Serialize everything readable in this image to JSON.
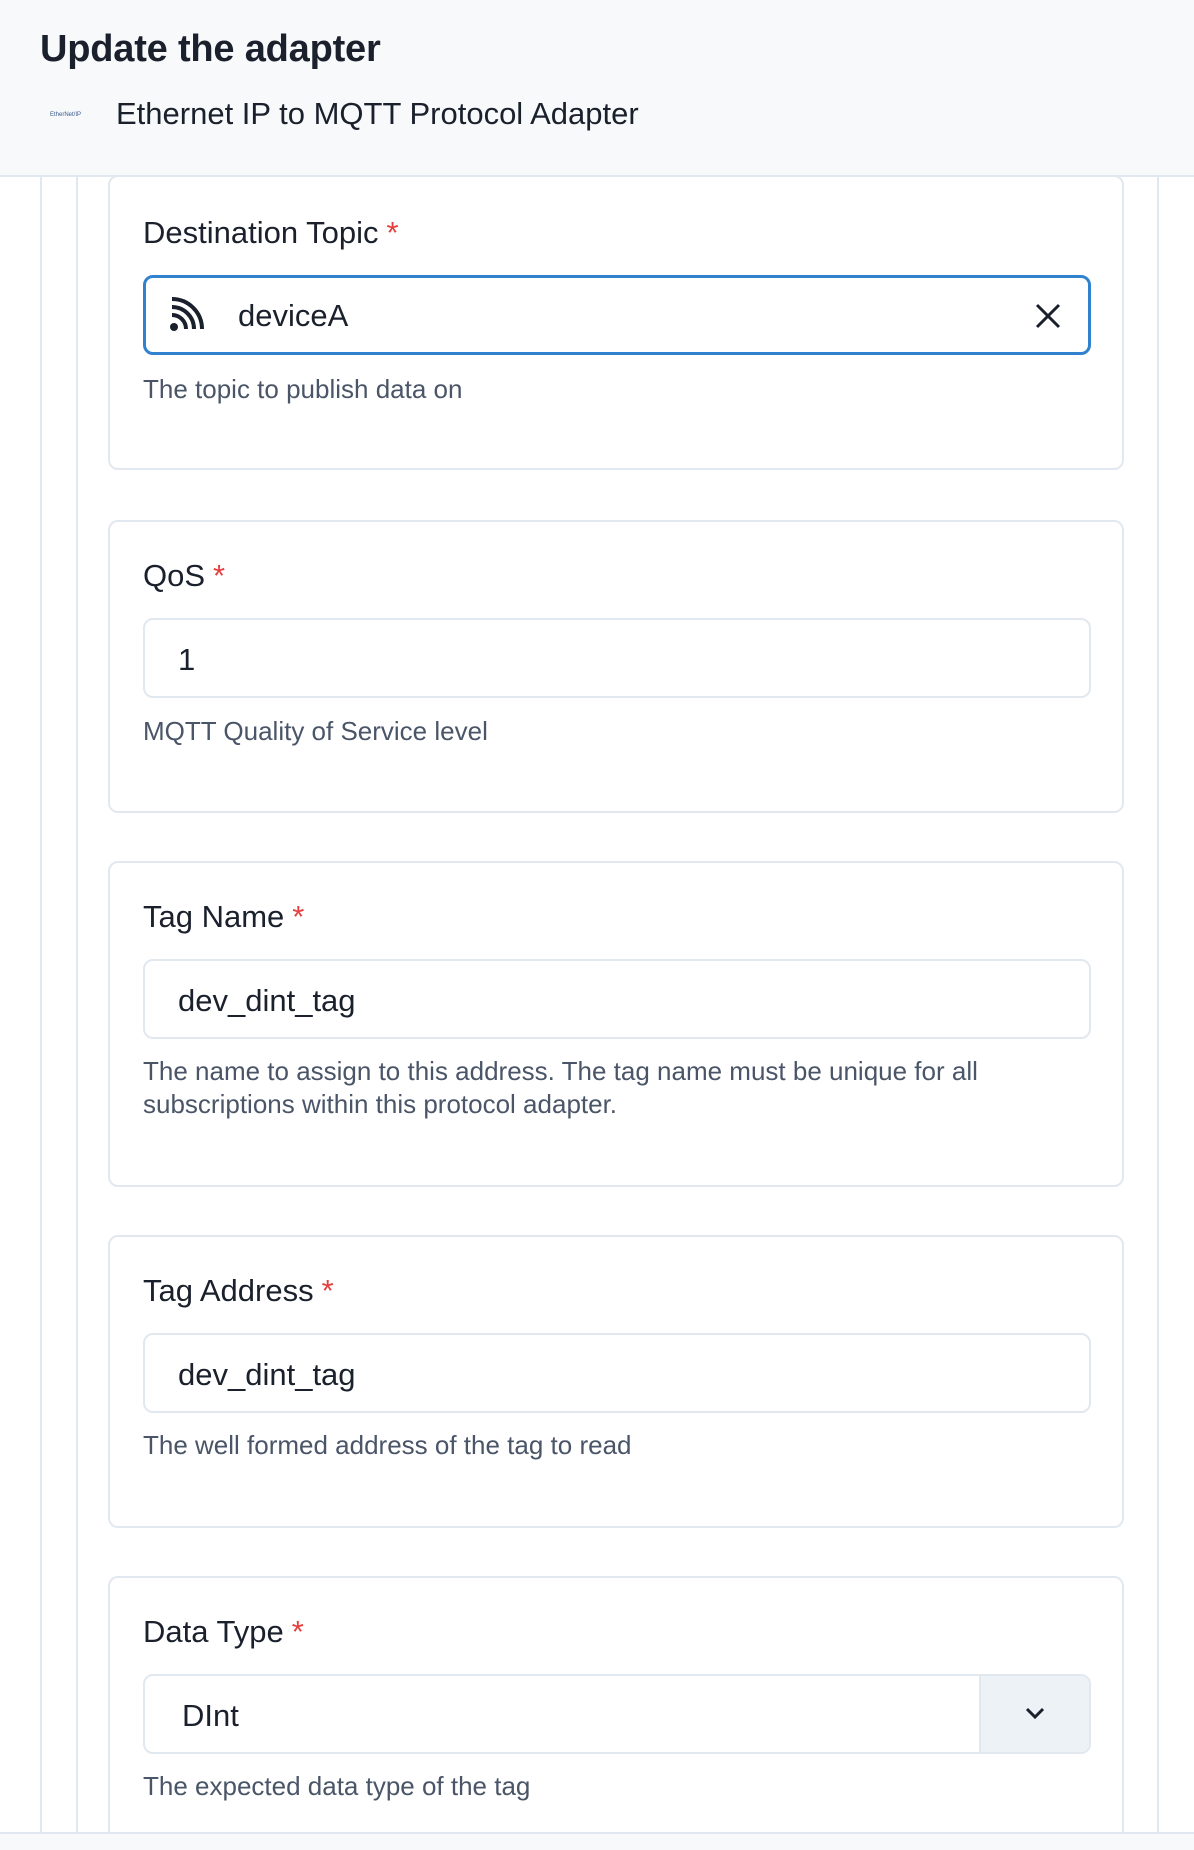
{
  "header": {
    "title": "Update the adapter",
    "logo_text": "EtherNet/IP",
    "subtitle": "Ethernet IP to MQTT Protocol Adapter"
  },
  "fields": {
    "destination_topic": {
      "label": "Destination Topic",
      "required_mark": "*",
      "value": "deviceA",
      "helper": "The topic to publish data on",
      "icon": "topic-icon",
      "clear_icon": "close-icon"
    },
    "qos": {
      "label": "QoS",
      "required_mark": "*",
      "value": "1",
      "helper": "MQTT Quality of Service level"
    },
    "tag_name": {
      "label": "Tag Name",
      "required_mark": "*",
      "value": "dev_dint_tag",
      "helper": "The name to assign to this address. The tag name must be unique for all subscriptions within this protocol adapter."
    },
    "tag_address": {
      "label": "Tag Address",
      "required_mark": "*",
      "value": "dev_dint_tag",
      "helper": "The well formed address of the tag to read"
    },
    "data_type": {
      "label": "Data Type",
      "required_mark": "*",
      "value": "DInt",
      "helper": "The expected data type of the tag",
      "icon": "chevron-down-icon"
    }
  },
  "colors": {
    "accent": "#3182ce",
    "required": "#e53e3e",
    "border": "#e2e8f0",
    "header_bg": "#f7f9fb"
  }
}
